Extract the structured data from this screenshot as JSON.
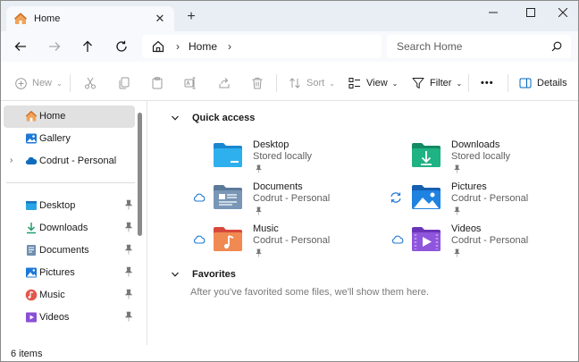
{
  "tab": {
    "title": "Home",
    "close": "✕",
    "new_tab": "+"
  },
  "window_controls": {
    "minimize": "—",
    "maximize": "☐",
    "close": "✕"
  },
  "address": {
    "crumb": "Home",
    "separator": "›"
  },
  "search": {
    "placeholder": "Search Home"
  },
  "commands": {
    "new": "New",
    "sort": "Sort",
    "view": "View",
    "filter": "Filter",
    "more": "•••",
    "details": "Details"
  },
  "sidebar": {
    "items": [
      {
        "label": "Home",
        "icon": "home-icon"
      },
      {
        "label": "Gallery",
        "icon": "gallery-icon"
      },
      {
        "label": "Codrut - Personal",
        "icon": "onedrive-icon"
      },
      {
        "label": "Desktop",
        "icon": "desktop-folder-icon"
      },
      {
        "label": "Downloads",
        "icon": "downloads-icon"
      },
      {
        "label": "Documents",
        "icon": "documents-icon"
      },
      {
        "label": "Pictures",
        "icon": "pictures-icon"
      },
      {
        "label": "Music",
        "icon": "music-icon"
      },
      {
        "label": "Videos",
        "icon": "videos-icon"
      }
    ]
  },
  "quick_access": {
    "title": "Quick access",
    "items": [
      {
        "name": "Desktop",
        "sub": "Stored locally",
        "status": "none"
      },
      {
        "name": "Downloads",
        "sub": "Stored locally",
        "status": "none"
      },
      {
        "name": "Documents",
        "sub": "Codrut - Personal",
        "status": "cloud"
      },
      {
        "name": "Pictures",
        "sub": "Codrut - Personal",
        "status": "sync"
      },
      {
        "name": "Music",
        "sub": "Codrut - Personal",
        "status": "cloud"
      },
      {
        "name": "Videos",
        "sub": "Codrut - Personal",
        "status": "cloud"
      }
    ]
  },
  "favorites": {
    "title": "Favorites",
    "empty_text": "After you've favorited some files, we'll show them here."
  },
  "status": {
    "count": "6 items"
  },
  "colors": {
    "accent": "#0067c0",
    "selected": "#e1e1e1",
    "titlebar": "#e9eef5"
  }
}
